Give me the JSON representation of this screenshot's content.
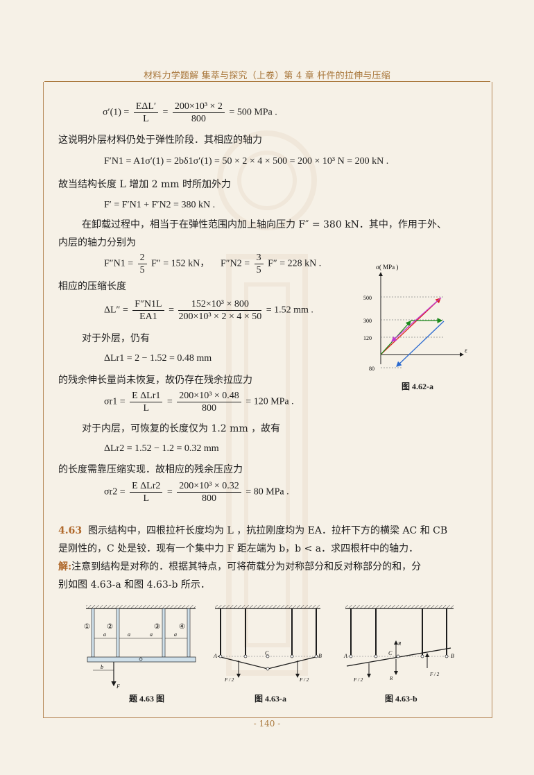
{
  "header": {
    "title": "材料力学题解 集萃与探究（上卷）第 4 章 杆件的拉伸与压缩"
  },
  "footer": {
    "page": "- 140 -"
  },
  "content": {
    "eq1": {
      "lhs": "σ′(1) =",
      "num1": "EΔL′",
      "den1": "L",
      "num2": "200×10³ × 2",
      "den2": "800",
      "rhs": "= 500 MPa ."
    },
    "p1": "这说明外层材料仍处于弹性阶段．其相应的轴力",
    "eq2": "F′N1 = A1σ′(1) = 2bδ1σ′(1) = 50 × 2 × 4 × 500 = 200 × 10³ N = 200 kN .",
    "p2": "故当结构长度 L 增加 2 mm 时所加外力",
    "eq3": "F′ = F′N1 + F′N2 = 380 kN .",
    "p3a": "在卸载过程中，相当于在弹性范围内加上轴向压力 F″ = 380 kN．其中，作用于外、",
    "p3b": "内层的轴力分别为",
    "eq4a_lhs": "F″N1 =",
    "eq4a_num": "2",
    "eq4a_den": "5",
    "eq4a_rhs": "F″ = 152 kN，",
    "eq4b_lhs": "F″N2 =",
    "eq4b_num": "3",
    "eq4b_den": "5",
    "eq4b_rhs": "F″ = 228 kN .",
    "p4": "相应的压缩长度",
    "eq5": {
      "lhs": "ΔL″ =",
      "num1": "F″N1L",
      "den1": "EA1",
      "num2": "152×10³ × 800",
      "den2": "200×10³ × 2 × 4 × 50",
      "rhs": "= 1.52 mm ."
    },
    "p5": "对于外层，仍有",
    "eq6": "ΔLr1 = 2 − 1.52 = 0.48 mm",
    "p6": "的残余伸长量尚未恢复，故仍存在残余拉应力",
    "eq7": {
      "lhs": "σr1 =",
      "num1": "E ΔLr1",
      "den1": "L",
      "num2": "200×10³ × 0.48",
      "den2": "800",
      "rhs": "= 120 MPa ."
    },
    "p7": "对于内层，可恢复的长度仅为 1.2 mm ，故有",
    "eq8": "ΔLr2 = 1.52 − 1.2 = 0.32 mm",
    "p8": "的长度需靠压缩实现．故相应的残余压应力",
    "eq9": {
      "lhs": "σr2 =",
      "num1": "E ΔLr2",
      "den1": "L",
      "num2": "200×10³ × 0.32",
      "den2": "800",
      "rhs": "= 80 MPa ."
    },
    "problem": {
      "number": "4.63",
      "line1": "图示结构中，四根拉杆长度均为 L ，抗拉刚度均为 EA．拉杆下方的横梁 AC 和 CB",
      "line2": "是刚性的，C 处是铰．现有一个集中力 F 距左端为 b，b < a．求四根杆中的轴力．",
      "sol_label": "解:",
      "line3": "注意到结构是对称的．根据其特点，可将荷载分为对称部分和反对称部分的和，分",
      "line4": "别如图 4.63-a 和图 4.63-b 所示．"
    }
  },
  "figure_462": {
    "caption": "图 4.62-a",
    "y_axis": "σ( MPa )",
    "x_axis": "ε",
    "ticks": [
      "500",
      "300",
      "120",
      "80"
    ]
  },
  "figures_463": {
    "cap0": "题 4.63 图",
    "cap_a": "图 4.63-a",
    "cap_b": "图 4.63-b",
    "labels": {
      "A": "A",
      "B": "B",
      "C": "C",
      "F": "F",
      "F2": "F / 2",
      "R": "R",
      "a": "a",
      "b": "b",
      "c1": "①",
      "c2": "②",
      "c3": "③",
      "c4": "④"
    }
  }
}
